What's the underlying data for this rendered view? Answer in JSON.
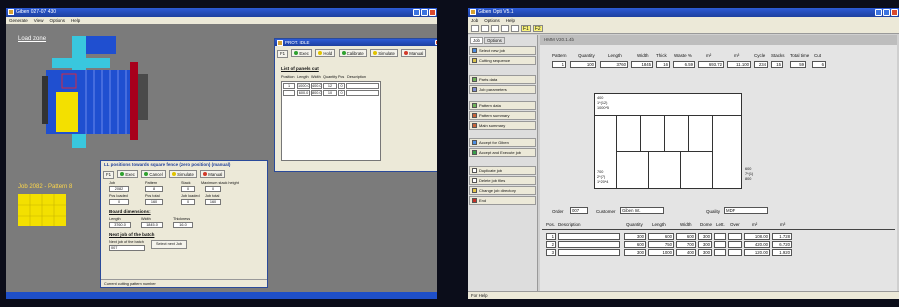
{
  "left_app": {
    "title": "Giben 027-07 430",
    "menu": [
      "Generate",
      "View",
      "Options",
      "Help"
    ],
    "load_zone_label": "Load zone",
    "job_label": "Job 2082 - Pattern 8",
    "cut_dialog": {
      "title": "PROT. IDLE",
      "tabs": [
        "F1",
        "Exec",
        "Hold",
        "Calibrate",
        "Simulate",
        "Manual"
      ],
      "heading": "List of panels cut",
      "columns": [
        "Position",
        "Length",
        "Width",
        "Quantity",
        "Pcs",
        "Description"
      ],
      "rows": [
        [
          "1",
          "1000.0",
          "400.0",
          "12",
          "0",
          ""
        ],
        [
          "",
          "600.0",
          "800.0",
          "10",
          "0",
          ""
        ]
      ]
    },
    "lp_dialog": {
      "title": "LL positions towards square fence (zero position) (manual)",
      "tabs": [
        "F1",
        "Exec",
        "Cancel",
        "Simulate",
        "Manual"
      ],
      "fields": [
        {
          "label": "Job",
          "value": "2082"
        },
        {
          "label": "Pattern",
          "value": "8"
        },
        {
          "label": "Stack",
          "value": "0"
        },
        {
          "label": "Maximum stack height",
          "value": "0"
        },
        {
          "label": "Pcs loaded",
          "value": "0"
        },
        {
          "label": "Pcs total",
          "value": "160"
        },
        {
          "label": "Job loaded",
          "value": "0"
        },
        {
          "label": "Job total",
          "value": "160"
        }
      ],
      "board_heading": "Board dimensions:",
      "board": [
        {
          "label": "Length",
          "value": "3760.0"
        },
        {
          "label": "Width",
          "value": "1845.0"
        },
        {
          "label": "Thickness",
          "value": "16.0"
        }
      ],
      "next_heading": "Next job of the batch",
      "next_label": "Next job of the batch",
      "next_value": "007",
      "select_button": "Select next Job",
      "status": "Current cutting pattern number"
    },
    "colors": {
      "background": "#7b7b7b",
      "yellow": "#f3e000",
      "red": "#a8001c",
      "blue": "#1f4fd0",
      "cyan": "#39c7de"
    }
  },
  "right_app": {
    "title": "Giben Opti V5.1",
    "menu": [
      "Job",
      "Options",
      "Help"
    ],
    "toolbar_keys": [
      "F1",
      "F2"
    ],
    "sidebar_tabs": [
      "Job",
      "Options"
    ],
    "sidebar": [
      "Select new job",
      "Cutting sequence",
      "Parts data",
      "Job parameters",
      "Pattern data",
      "Pattern summary",
      "Main summary",
      "Accept for Giben",
      "Accept and Execute job",
      "Duplicate job",
      "Delete job files",
      "Change job directory",
      "End"
    ],
    "pattern_strip": "HMM V20.1.4b",
    "pattern_headers": [
      "Pattern",
      "Quantity",
      "Length",
      "Width",
      "Thick",
      "Waste %",
      "m²",
      "m³",
      "Cycle",
      "Stacks",
      "Total time",
      "Cut"
    ],
    "pattern_row": [
      "1",
      "100",
      "3760",
      "1845",
      "16",
      "6.59",
      "693.72",
      "11.100",
      "234",
      "15",
      "59",
      "6"
    ],
    "preview_labels": [
      "400",
      "1*(12)",
      "1000*5",
      "700",
      "2*(7)",
      "1*20*4",
      "600",
      "7*(1)",
      "800"
    ],
    "order_label": "Order",
    "order_value": "007",
    "customer_label": "Customer",
    "customer_value": "Giben Int.",
    "quality_label": "Quality",
    "quality_value": "MDF",
    "parts_headers": [
      "Pos.",
      "Description",
      "Quantity",
      "Length",
      "Width",
      "Dome",
      "Lett.",
      "Over",
      "m²",
      "m³"
    ],
    "parts_rows": [
      [
        "1",
        "",
        "300",
        "600",
        "600",
        "300",
        "",
        "",
        "108.00",
        "1.728"
      ],
      [
        "2",
        "",
        "600",
        "750",
        "700",
        "300",
        "",
        "",
        "420.00",
        "6.720"
      ],
      [
        "3",
        "",
        "300",
        "1000",
        "400",
        "300",
        "",
        "",
        "120.00",
        "1.920"
      ]
    ],
    "status": "For Help"
  }
}
